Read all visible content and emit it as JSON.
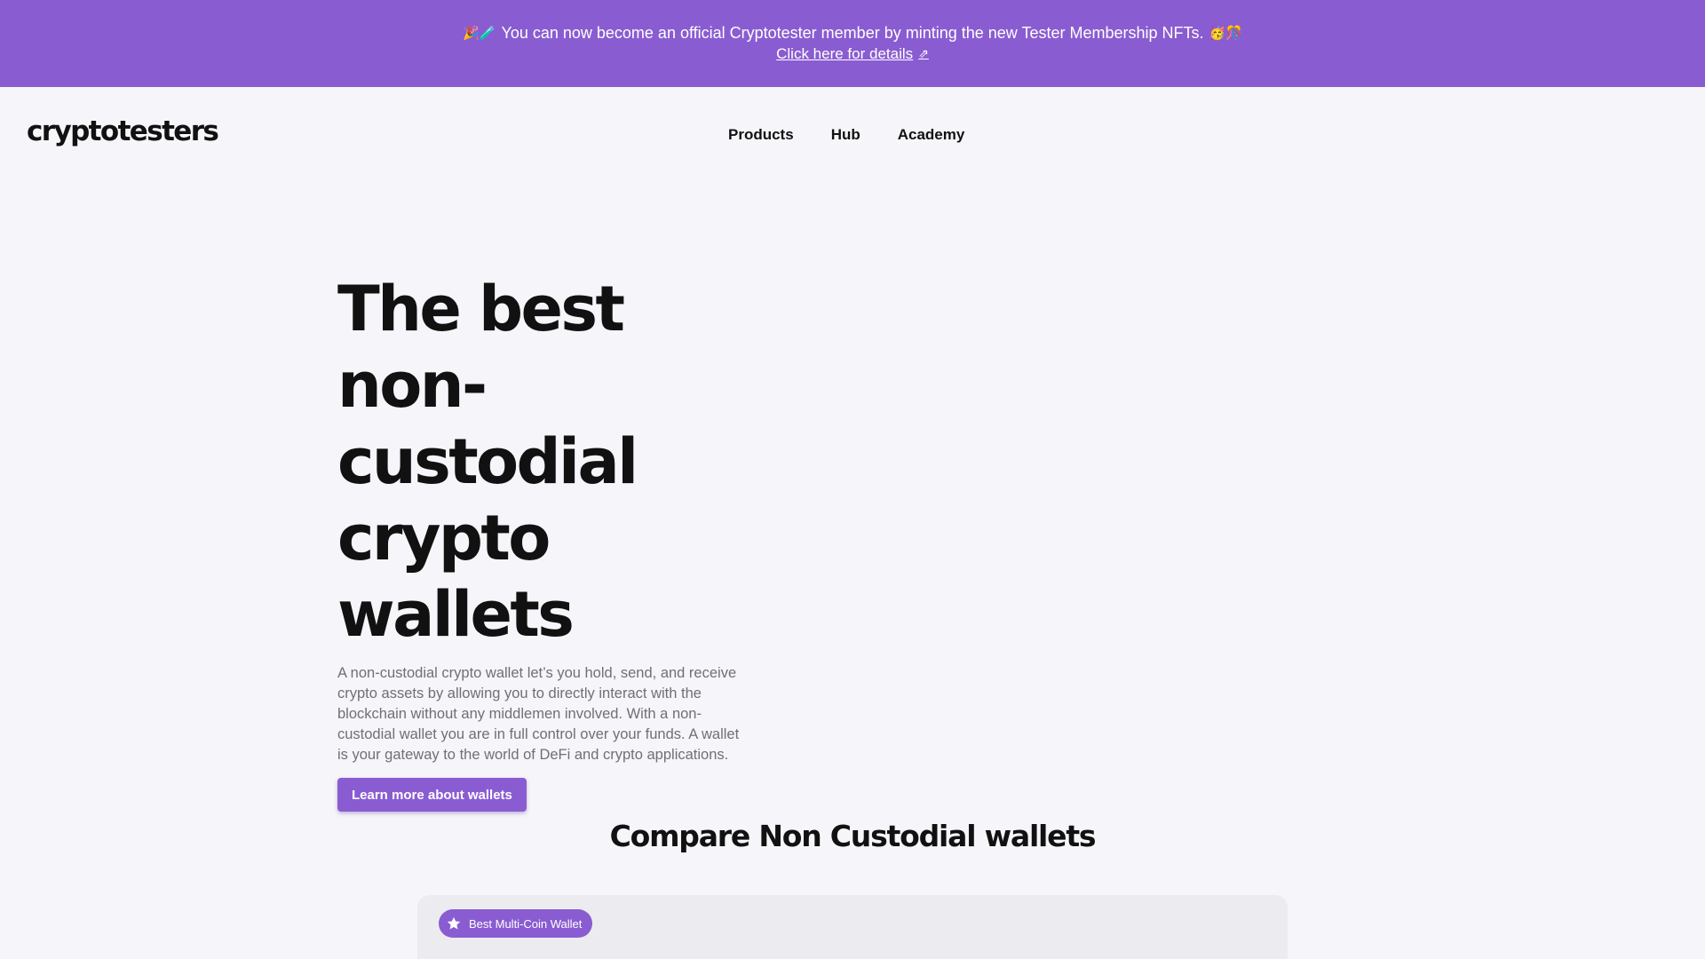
{
  "banner": {
    "emoji_left": "🎉🧪",
    "message": "You can now become an official Cryptotester member by minting the new Tester Membership NFTs.",
    "emoji_right": "🥳🎊",
    "link_label": "Click here for details",
    "link_icon": "⇗"
  },
  "nav": {
    "logo": "cryptotesters",
    "items": [
      {
        "label": "Products"
      },
      {
        "label": "Hub"
      },
      {
        "label": "Academy"
      }
    ]
  },
  "hero": {
    "title_lines": [
      "The best non-",
      "custodial",
      "crypto wallets"
    ],
    "description": "A non-custodial crypto wallet let’s you hold, send, and receive crypto assets by allowing you to directly interact with the blockchain without any middlemen involved. With a non-custodial wallet you are in full control over your funds. A wallet is your gateway to the world of DeFi and crypto applications.",
    "cta_label": "Learn more about wallets"
  },
  "compare": {
    "title": "Compare Non Custodial wallets",
    "card": {
      "badge_label": "Best Multi-Coin Wallet",
      "badge_icon": "star-icon"
    }
  },
  "colors": {
    "brand": "#8a5cd1",
    "background": "#f6f5f9",
    "card": "#ececf0",
    "text": "#111111",
    "muted": "#6f6f78"
  }
}
